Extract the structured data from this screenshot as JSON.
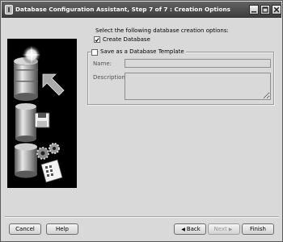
{
  "window": {
    "title": "Database Configuration Assistant, Step 7 of 7 : Creation Options"
  },
  "main": {
    "prompt": "Select the following database creation options:",
    "create_database": {
      "label": "Create Database",
      "checked": true
    },
    "save_template": {
      "label": "Save as a Database Template",
      "checked": false
    },
    "name_label": "Name:",
    "name_value": "",
    "description_label": "Description:",
    "description_value": ""
  },
  "footer": {
    "cancel": "Cancel",
    "help": "Help",
    "back": "Back",
    "next": "Next",
    "finish": "Finish"
  },
  "icons": {
    "sidebar": [
      "database-cylinder-icon",
      "arrow-icon",
      "floppy-disk-icon",
      "gears-icon",
      "script-document-icon"
    ]
  }
}
